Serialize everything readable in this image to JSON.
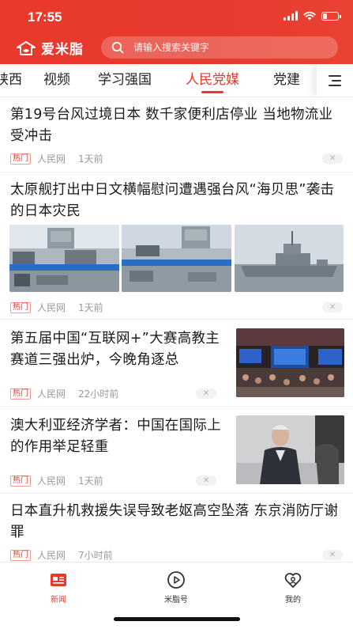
{
  "status_bar": {
    "time": "17:55"
  },
  "header": {
    "logo_text": "爱米脂",
    "search_placeholder": "请输入搜索关键字"
  },
  "tabs": [
    {
      "label": "陕西",
      "active": false
    },
    {
      "label": "视频",
      "active": false
    },
    {
      "label": "学习强国",
      "active": false
    },
    {
      "label": "人民党媒",
      "active": true
    },
    {
      "label": "党建",
      "active": false
    }
  ],
  "feed": [
    {
      "title": "第19号台风过境日本 数千家便利店停业 当地物流业受冲击",
      "tag": "热门",
      "source": "人民网",
      "time": "1天前",
      "close": "✕"
    },
    {
      "title": "太原舰打出中日文横幅慰问遭遇强台风“海贝思”袭击的日本灾民",
      "tag": "热门",
      "source": "人民网",
      "time": "1天前",
      "close": "✕"
    },
    {
      "title": "第五届中国“互联网+”大赛高教主赛道三强出炉，今晚角逐总",
      "tag": "热门",
      "source": "人民网",
      "time": "22小时前",
      "close": "✕"
    },
    {
      "title": "澳大利亚经济学者：中国在国际上的作用举足轻重",
      "tag": "热门",
      "source": "人民网",
      "time": "1天前",
      "close": "✕"
    },
    {
      "title": "日本直升机救援失误导致老妪高空坠落 东京消防厅谢罪",
      "tag": "热门",
      "source": "人民网",
      "time": "7小时前",
      "close": "✕"
    }
  ],
  "bottom_nav": [
    {
      "label": "新闻",
      "icon": "news-icon",
      "active": true
    },
    {
      "label": "米脂号",
      "icon": "play-circle-icon",
      "active": false
    },
    {
      "label": "我的",
      "icon": "heart-person-icon",
      "active": false
    }
  ],
  "colors": {
    "brand": "#e8392c",
    "text": "#1a1a1a",
    "meta": "#9a9a9a"
  }
}
